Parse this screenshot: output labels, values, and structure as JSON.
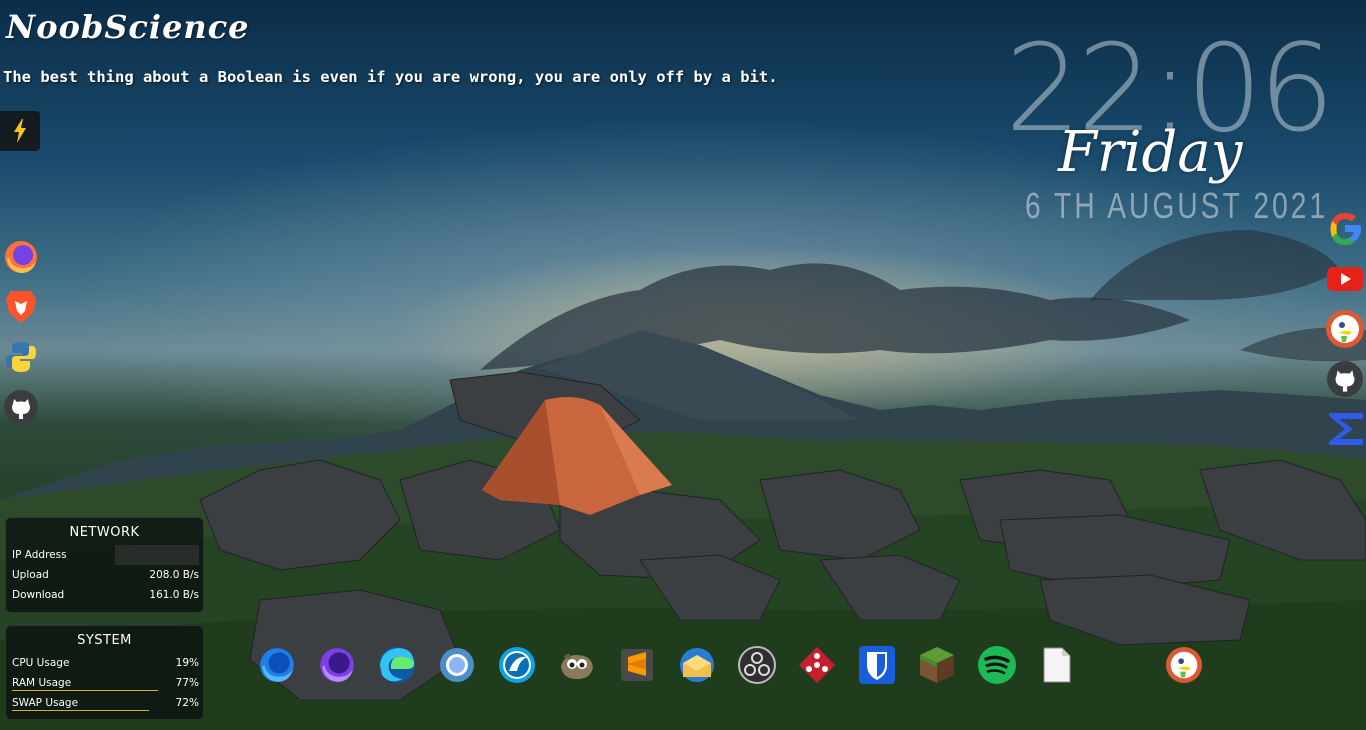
{
  "header": {
    "title": "NoobScience",
    "quote": "The best thing about a Boolean is even if you are wrong, you are only off by a bit."
  },
  "quick_button": {
    "icon": "lightning-bolt-icon",
    "color": "#f5c518"
  },
  "clock": {
    "time": "22:06",
    "day": "Friday",
    "date": "6 TH AUGUST 2021"
  },
  "left_sidebar": [
    {
      "name": "Firefox",
      "icon": "firefox-icon"
    },
    {
      "name": "Brave",
      "icon": "brave-icon"
    },
    {
      "name": "Python",
      "icon": "python-icon"
    },
    {
      "name": "GitHub",
      "icon": "github-icon"
    }
  ],
  "right_sidebar": [
    {
      "name": "Google",
      "icon": "google-icon"
    },
    {
      "name": "YouTube",
      "icon": "youtube-icon"
    },
    {
      "name": "DuckDuckGo",
      "icon": "duckduckgo-icon"
    },
    {
      "name": "GitHub",
      "icon": "github-icon"
    },
    {
      "name": "Sigma",
      "icon": "sigma-icon"
    }
  ],
  "network": {
    "title": "NETWORK",
    "rows": [
      {
        "label": "IP Address",
        "value": ""
      },
      {
        "label": "Upload",
        "value": "208.0 B/s"
      },
      {
        "label": "Download",
        "value": "161.0 B/s"
      }
    ]
  },
  "system": {
    "title": "SYSTEM",
    "rows": [
      {
        "label": "CPU Usage",
        "value": "19%",
        "percent": 19
      },
      {
        "label": "RAM Usage",
        "value": "77%",
        "percent": 77
      },
      {
        "label": "SWAP Usage",
        "value": "72%",
        "percent": 72
      }
    ]
  },
  "dock": [
    {
      "name": "Firefox",
      "icon": "firefox-icon"
    },
    {
      "name": "Firefox Nightly",
      "icon": "firefox-nightly-icon"
    },
    {
      "name": "Microsoft Edge",
      "icon": "edge-icon"
    },
    {
      "name": "Chromium",
      "icon": "chromium-icon"
    },
    {
      "name": "Waterfox",
      "icon": "waterfox-icon"
    },
    {
      "name": "GIMP",
      "icon": "gimp-icon"
    },
    {
      "name": "Sublime Text",
      "icon": "sublime-icon"
    },
    {
      "name": "Mail",
      "icon": "mail-icon"
    },
    {
      "name": "OBS Studio",
      "icon": "obs-icon"
    },
    {
      "name": "Dice Game",
      "icon": "dice-icon"
    },
    {
      "name": "Bitwarden",
      "icon": "bitwarden-icon"
    },
    {
      "name": "Minecraft",
      "icon": "minecraft-icon"
    },
    {
      "name": "Spotify",
      "icon": "spotify-icon"
    },
    {
      "name": "Files",
      "icon": "file-icon"
    },
    {
      "name": "DuckDuckGo",
      "icon": "duckduckgo-icon"
    }
  ]
}
